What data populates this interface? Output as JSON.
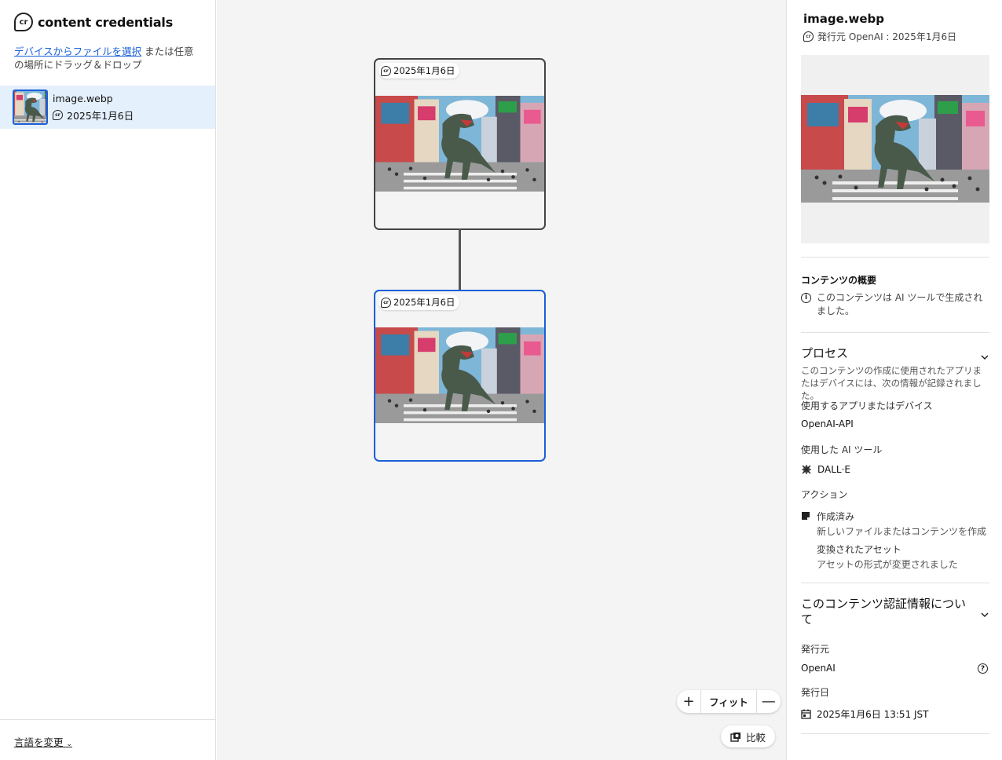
{
  "brand": {
    "name": "content credentials",
    "logo_text": "cr"
  },
  "upload": {
    "link": "デバイスからファイルを選択",
    "rest": " または任意の場所にドラッグ＆ドロップ"
  },
  "files": [
    {
      "name": "image.webp",
      "date": "2025年1月6日"
    }
  ],
  "footer": {
    "language": "言語を変更"
  },
  "canvas": {
    "nodes": [
      {
        "date": "2025年1月6日"
      },
      {
        "date": "2025年1月6日"
      }
    ],
    "zoom": {
      "fit_label": "フィット"
    },
    "compare_label": "比較"
  },
  "panel": {
    "title": "image.webp",
    "issuer_line": "発行元 OpenAI : 2025年1月6日",
    "summary": {
      "heading": "コンテンツの概要",
      "text": "このコンテンツは AI ツールで生成されました。"
    },
    "process": {
      "heading": "プロセス",
      "description": "このコンテンツの作成に使用されたアプリまたはデバイスには、次の情報が記録されました。",
      "app_label": "使用するアプリまたはデバイス",
      "app_value": "OpenAI-API",
      "ai_label": "使用した AI ツール",
      "ai_value": "DALL·E",
      "actions_label": "アクション",
      "actions": [
        {
          "title": "作成済み",
          "desc": "新しいファイルまたはコンテンツを作成"
        },
        {
          "title": "変換されたアセット",
          "desc": "アセットの形式が変更されました"
        }
      ]
    },
    "about": {
      "heading": "このコンテンツ認証情報について",
      "issuer_label": "発行元",
      "issuer_value": "OpenAI",
      "date_label": "発行日",
      "date_value": "2025年1月6日 13:51 JST"
    }
  },
  "icons": {
    "cr": "cr-logo-icon",
    "info": "info-icon",
    "help": "help-icon",
    "chevron": "chevron-down-icon",
    "calendar": "calendar-icon",
    "ai": "ai-tool-icon",
    "created": "created-icon",
    "compare": "compare-icon",
    "zoom_in": "plus-icon",
    "zoom_out": "minus-icon"
  },
  "colors": {
    "accent": "#1a5fd8",
    "selected_bg": "#e4f0fc",
    "canvas_bg": "#f4f4f4"
  }
}
